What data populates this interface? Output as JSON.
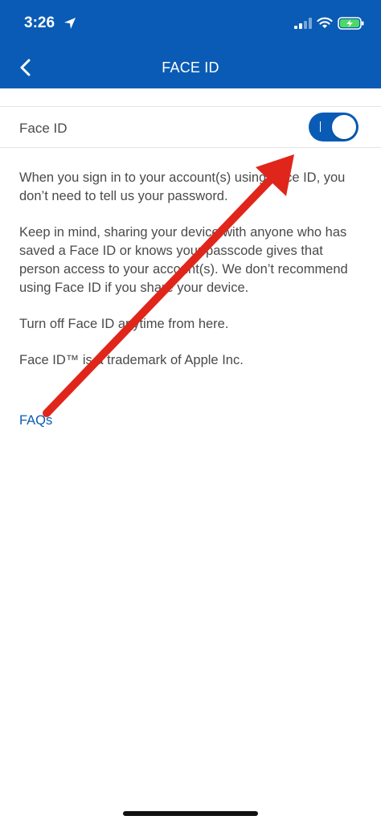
{
  "status_bar": {
    "time": "3:26",
    "accent_color": "#0a5bb5"
  },
  "header": {
    "title": "FACE ID",
    "back_icon": "chevron-left-icon"
  },
  "setting": {
    "label": "Face ID",
    "toggle_on": true
  },
  "body": {
    "paragraphs": [
      "When you sign in to your account(s) using Face ID, you don’t need to tell us your password.",
      "Keep in mind, sharing your device with anyone who has saved a Face ID or knows your passcode gives that person access to your account(s).  We don’t recommend using Face ID if you share your device.",
      "Turn off Face ID anytime from here.",
      "Face ID™ is a trademark of Apple Inc."
    ],
    "faq_link": "FAQs"
  },
  "annotation": {
    "arrow_color": "#e0261b"
  }
}
